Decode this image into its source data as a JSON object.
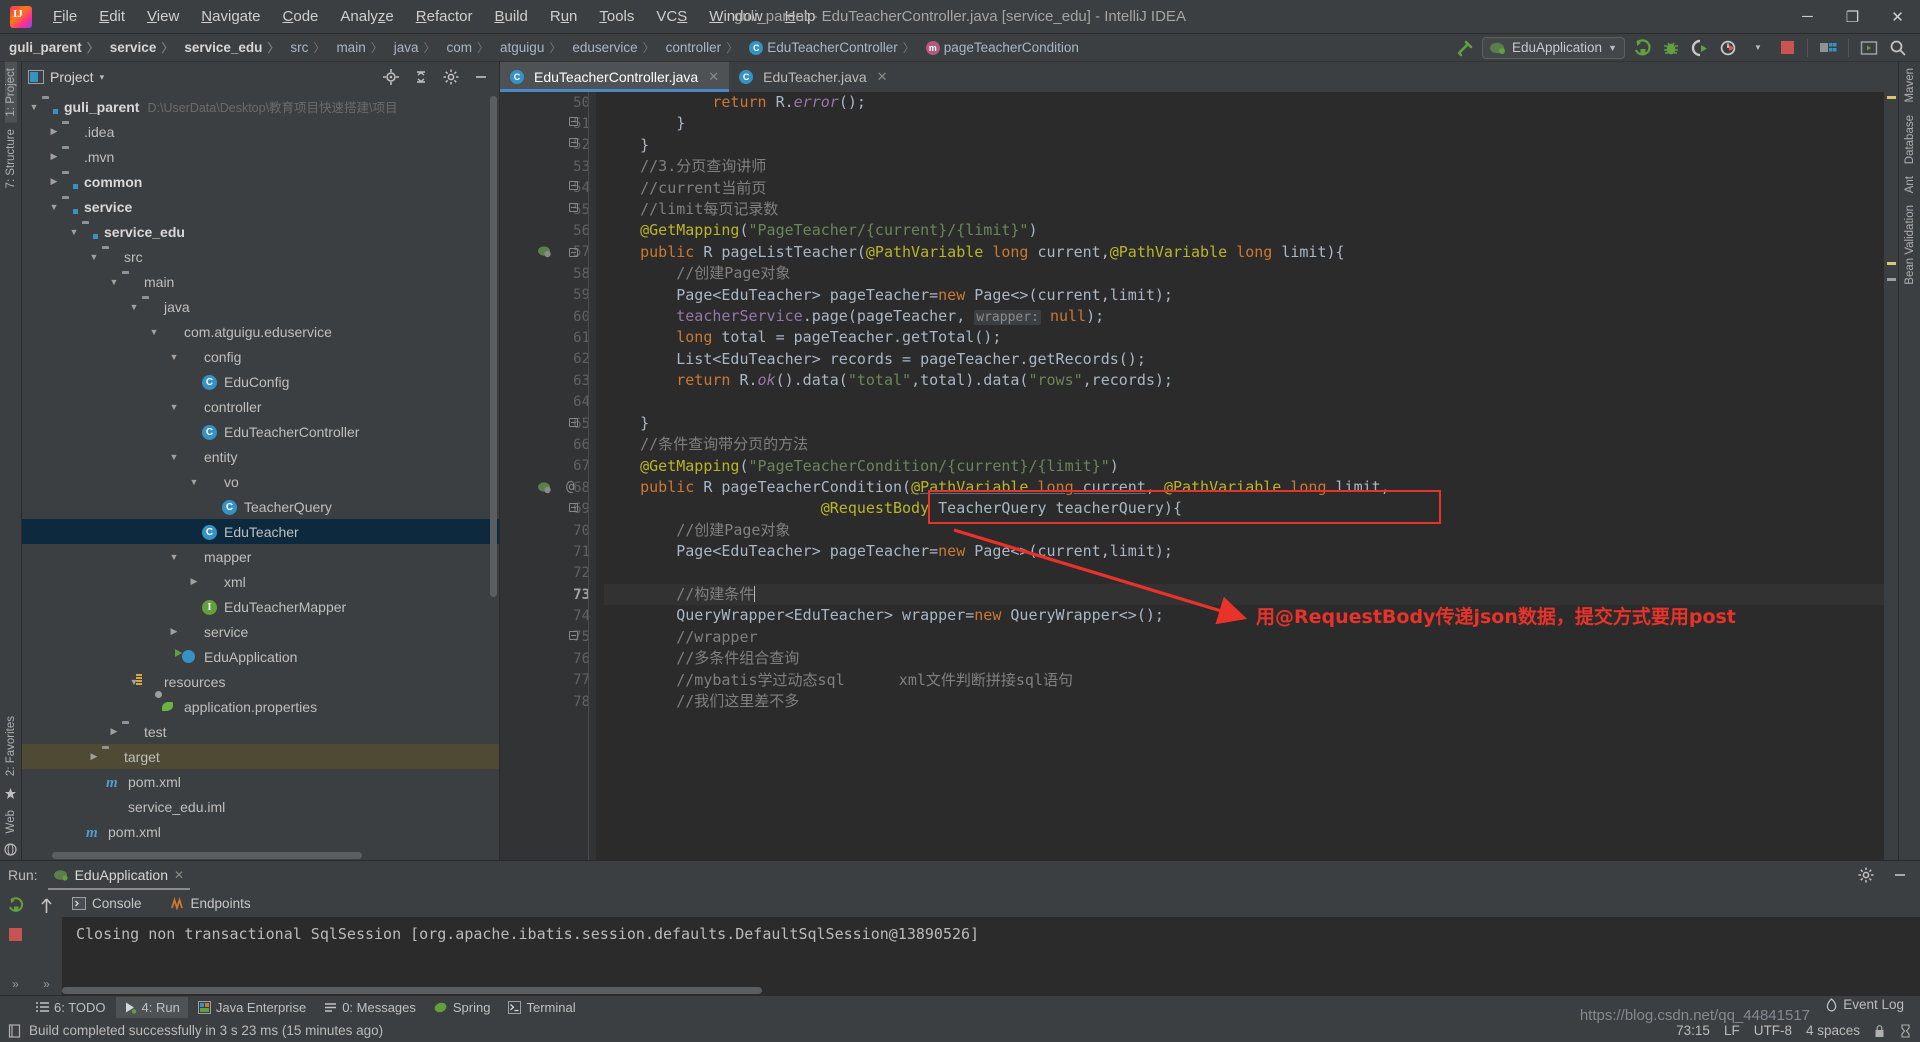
{
  "titlebar": {
    "window_title": "guli_parent - EduTeacherController.java [service_edu] - IntelliJ IDEA",
    "logo_text": "IJ",
    "menus": [
      "File",
      "Edit",
      "View",
      "Navigate",
      "Code",
      "Analyze",
      "Refactor",
      "Build",
      "Run",
      "Tools",
      "VCS",
      "Window",
      "Help"
    ],
    "window_buttons": {
      "minimize": "─",
      "maximize": "❐",
      "close": "✕"
    }
  },
  "navbar": {
    "crumbs": [
      {
        "label": "guli_parent",
        "bold": true,
        "icon": ""
      },
      {
        "label": "service",
        "bold": true,
        "icon": ""
      },
      {
        "label": "service_edu",
        "bold": true,
        "icon": ""
      },
      {
        "label": "src",
        "bold": false,
        "icon": ""
      },
      {
        "label": "main",
        "bold": false,
        "icon": ""
      },
      {
        "label": "java",
        "bold": false,
        "icon": ""
      },
      {
        "label": "com",
        "bold": false,
        "icon": ""
      },
      {
        "label": "atguigu",
        "bold": false,
        "icon": ""
      },
      {
        "label": "eduservice",
        "bold": false,
        "icon": ""
      },
      {
        "label": "controller",
        "bold": false,
        "icon": ""
      },
      {
        "label": "EduTeacherController",
        "bold": false,
        "icon": "class"
      },
      {
        "label": "pageTeacherCondition",
        "bold": false,
        "icon": "method"
      }
    ],
    "separator": "〉",
    "run_config": "EduApplication",
    "run_config_caret": "▼",
    "toolbar_icons": [
      "run-icon",
      "debug-icon",
      "run-with-coverage-icon",
      "profiler-icon",
      "stop-icon",
      "project-structure-icon",
      "open-preview-icon",
      "search-everywhere-icon"
    ]
  },
  "left_rail": {
    "top": [
      {
        "label": "1: Project",
        "active": true
      },
      {
        "label": "7: Structure",
        "active": false
      }
    ],
    "bottom": [
      {
        "label": "2: Favorites",
        "active": false
      },
      {
        "label": "Web",
        "active": false
      }
    ]
  },
  "right_rail": {
    "items": [
      "Maven",
      "Database",
      "Ant",
      "Bean Validation"
    ]
  },
  "project_panel": {
    "title": "Project",
    "caret": "▾",
    "header_icons": [
      "locate-icon",
      "collapse-all-icon",
      "settings-icon",
      "hide-icon"
    ],
    "tree": [
      {
        "depth": 0,
        "arrow": "down",
        "icon": "module",
        "label": "guli_parent",
        "bold": true,
        "path": "D:\\UserData\\Desktop\\教育项目快速搭建\\项目"
      },
      {
        "depth": 1,
        "arrow": "right",
        "icon": "folder",
        "label": ".idea",
        "bold": false,
        "path": ""
      },
      {
        "depth": 1,
        "arrow": "right",
        "icon": "folder",
        "label": ".mvn",
        "bold": false,
        "path": ""
      },
      {
        "depth": 1,
        "arrow": "right",
        "icon": "module",
        "label": "common",
        "bold": true,
        "path": ""
      },
      {
        "depth": 1,
        "arrow": "down",
        "icon": "module",
        "label": "service",
        "bold": true,
        "path": ""
      },
      {
        "depth": 2,
        "arrow": "down",
        "icon": "module",
        "label": "service_edu",
        "bold": true,
        "path": ""
      },
      {
        "depth": 3,
        "arrow": "down",
        "icon": "folder",
        "label": "src",
        "bold": false,
        "path": ""
      },
      {
        "depth": 4,
        "arrow": "down",
        "icon": "folder",
        "label": "main",
        "bold": false,
        "path": ""
      },
      {
        "depth": 5,
        "arrow": "down",
        "icon": "srcroot",
        "label": "java",
        "bold": false,
        "path": ""
      },
      {
        "depth": 6,
        "arrow": "down",
        "icon": "package",
        "label": "com.atguigu.eduservice",
        "bold": false,
        "path": ""
      },
      {
        "depth": 7,
        "arrow": "down",
        "icon": "package",
        "label": "config",
        "bold": false,
        "path": ""
      },
      {
        "depth": 8,
        "arrow": "none",
        "icon": "class",
        "label": "EduConfig",
        "bold": false,
        "path": ""
      },
      {
        "depth": 7,
        "arrow": "down",
        "icon": "package",
        "label": "controller",
        "bold": false,
        "path": ""
      },
      {
        "depth": 8,
        "arrow": "none",
        "icon": "class",
        "label": "EduTeacherController",
        "bold": false,
        "path": ""
      },
      {
        "depth": 7,
        "arrow": "down",
        "icon": "package",
        "label": "entity",
        "bold": false,
        "path": ""
      },
      {
        "depth": 8,
        "arrow": "down",
        "icon": "package",
        "label": "vo",
        "bold": false,
        "path": ""
      },
      {
        "depth": 9,
        "arrow": "none",
        "icon": "class",
        "label": "TeacherQuery",
        "bold": false,
        "path": ""
      },
      {
        "depth": 8,
        "arrow": "none",
        "icon": "class",
        "label": "EduTeacher",
        "bold": false,
        "path": "",
        "selected": true
      },
      {
        "depth": 7,
        "arrow": "down",
        "icon": "package",
        "label": "mapper",
        "bold": false,
        "path": ""
      },
      {
        "depth": 8,
        "arrow": "right",
        "icon": "package",
        "label": "xml",
        "bold": false,
        "path": ""
      },
      {
        "depth": 8,
        "arrow": "none",
        "icon": "interface",
        "label": "EduTeacherMapper",
        "bold": false,
        "path": ""
      },
      {
        "depth": 7,
        "arrow": "right",
        "icon": "package",
        "label": "service",
        "bold": false,
        "path": ""
      },
      {
        "depth": 7,
        "arrow": "none",
        "icon": "springboot",
        "label": "EduApplication",
        "bold": false,
        "path": ""
      },
      {
        "depth": 5,
        "arrow": "down",
        "icon": "resources",
        "label": "resources",
        "bold": false,
        "path": ""
      },
      {
        "depth": 6,
        "arrow": "none",
        "icon": "spring",
        "label": "application.properties",
        "bold": false,
        "path": ""
      },
      {
        "depth": 4,
        "arrow": "right",
        "icon": "folder",
        "label": "test",
        "bold": false,
        "path": ""
      },
      {
        "depth": 3,
        "arrow": "right",
        "icon": "target",
        "label": "target",
        "bold": false,
        "path": "",
        "highlight": true
      },
      {
        "depth": 4,
        "arrow": "none",
        "icon": "maven",
        "label": "pom.xml",
        "bold": false,
        "path": ""
      },
      {
        "depth": 4,
        "arrow": "none",
        "icon": "iml",
        "label": "service_edu.iml",
        "bold": false,
        "path": ""
      },
      {
        "depth": 3,
        "arrow": "none",
        "icon": "maven",
        "label": "pom.xml",
        "bold": false,
        "path": ""
      }
    ]
  },
  "editor": {
    "tabs": [
      {
        "label": "EduTeacherController.java",
        "icon": "class",
        "active": true,
        "close": "✕"
      },
      {
        "label": "EduTeacher.java",
        "icon": "class",
        "active": false,
        "close": "✕"
      }
    ],
    "first_line_number": 50,
    "current_line": 73,
    "lines": [
      {
        "n": 50,
        "text": "            return R.error();"
      },
      {
        "n": 51,
        "text": "        }"
      },
      {
        "n": 52,
        "text": "    }"
      },
      {
        "n": 53,
        "text": "    //3.分页查询讲师"
      },
      {
        "n": 54,
        "text": "    //current当前页"
      },
      {
        "n": 55,
        "text": "    //limit每页记录数"
      },
      {
        "n": 56,
        "text": "    @GetMapping(\"PageTeacher/{current}/{limit}\")"
      },
      {
        "n": 57,
        "text": "    public R pageListTeacher(@PathVariable long current,@PathVariable long limit){"
      },
      {
        "n": 58,
        "text": "        //创建Page对象"
      },
      {
        "n": 59,
        "text": "        Page<EduTeacher> pageTeacher=new Page<>(current,limit);"
      },
      {
        "n": 60,
        "text": "        teacherService.page(pageTeacher, wrapper: null);"
      },
      {
        "n": 61,
        "text": "        long total = pageTeacher.getTotal();"
      },
      {
        "n": 62,
        "text": "        List<EduTeacher> records = pageTeacher.getRecords();"
      },
      {
        "n": 63,
        "text": "        return R.ok().data(\"total\",total).data(\"rows\",records);"
      },
      {
        "n": 64,
        "text": ""
      },
      {
        "n": 65,
        "text": "    }"
      },
      {
        "n": 66,
        "text": "    //条件查询带分页的方法"
      },
      {
        "n": 67,
        "text": "    @GetMapping(\"PageTeacherCondition/{current}/{limit}\")"
      },
      {
        "n": 68,
        "text": "    public R pageTeacherCondition(@PathVariable long current, @PathVariable long limit,"
      },
      {
        "n": 69,
        "text": "                        @RequestBody TeacherQuery teacherQuery){"
      },
      {
        "n": 70,
        "text": "        //创建Page对象"
      },
      {
        "n": 71,
        "text": "        Page<EduTeacher> pageTeacher=new Page<>(current,limit);"
      },
      {
        "n": 72,
        "text": ""
      },
      {
        "n": 73,
        "text": "        //构建条件"
      },
      {
        "n": 74,
        "text": "        QueryWrapper<EduTeacher> wrapper=new QueryWrapper<>();"
      },
      {
        "n": 75,
        "text": "        //wrapper"
      },
      {
        "n": 76,
        "text": "        //多条件组合查询"
      },
      {
        "n": 77,
        "text": "        //mybatis学过动态sql      xml文件判断拼接sql语句"
      },
      {
        "n": 78,
        "text": "        //我们这里差不多"
      }
    ],
    "gutter_marks": [
      {
        "line": 57,
        "type": "spring-bean-icon"
      },
      {
        "line": 68,
        "type": "spring-bean-icon"
      },
      {
        "line": 68,
        "type": "annotation-marker",
        "glyph": "@"
      }
    ],
    "annotation": {
      "text": "用@RequestBody传递json数据，提交方式要用post",
      "color": "#e8322a",
      "box_target_line": 69
    }
  },
  "run_panel": {
    "run_label": "Run:",
    "run_tab": "EduApplication",
    "run_tab_close": "✕",
    "sub_tabs": [
      {
        "label": "Console",
        "active": true,
        "icon": "console-icon"
      },
      {
        "label": "Endpoints",
        "active": false,
        "icon": "endpoints-icon"
      }
    ],
    "console_text": "Closing non transactional SqlSession [org.apache.ibatis.session.defaults.DefaultSqlSession@13890526]",
    "header_icons": [
      "settings-icon",
      "hide-icon"
    ],
    "side_icons": [
      "rerun-icon",
      "stop-icon",
      "scroll-up-icon",
      "expand-icon",
      "expand-icon-2"
    ]
  },
  "bottom_tabs": [
    {
      "label": "6: TODO",
      "underline": "6",
      "icon": "todo-icon",
      "active": false
    },
    {
      "label": "4: Run",
      "underline": "4",
      "icon": "run-icon",
      "active": true
    },
    {
      "label": "Java Enterprise",
      "underline": "",
      "icon": "java-ee-icon",
      "active": false
    },
    {
      "label": "0: Messages",
      "underline": "0",
      "icon": "messages-icon",
      "active": false
    },
    {
      "label": "Spring",
      "underline": "",
      "icon": "spring-icon",
      "active": false
    },
    {
      "label": "Terminal",
      "underline": "",
      "icon": "terminal-icon",
      "active": false
    }
  ],
  "statusbar": {
    "message": "Build completed successfully in 3 s 23 ms (15 minutes ago)",
    "caret_position": "73:15",
    "line_separator": "LF",
    "encoding": "UTF-8",
    "indent": "4 spaces",
    "event_log": "Event Log",
    "watermark": "https://blog.csdn.net/qq_44841517"
  },
  "colors": {
    "accent_blue": "#3592c4",
    "annotation_red": "#e8322a",
    "keyword_orange": "#cc7832",
    "string_green": "#6a8759",
    "annotation_yellow": "#bbb529",
    "field_purple": "#9876aa",
    "selection_blue": "#0d293e"
  }
}
